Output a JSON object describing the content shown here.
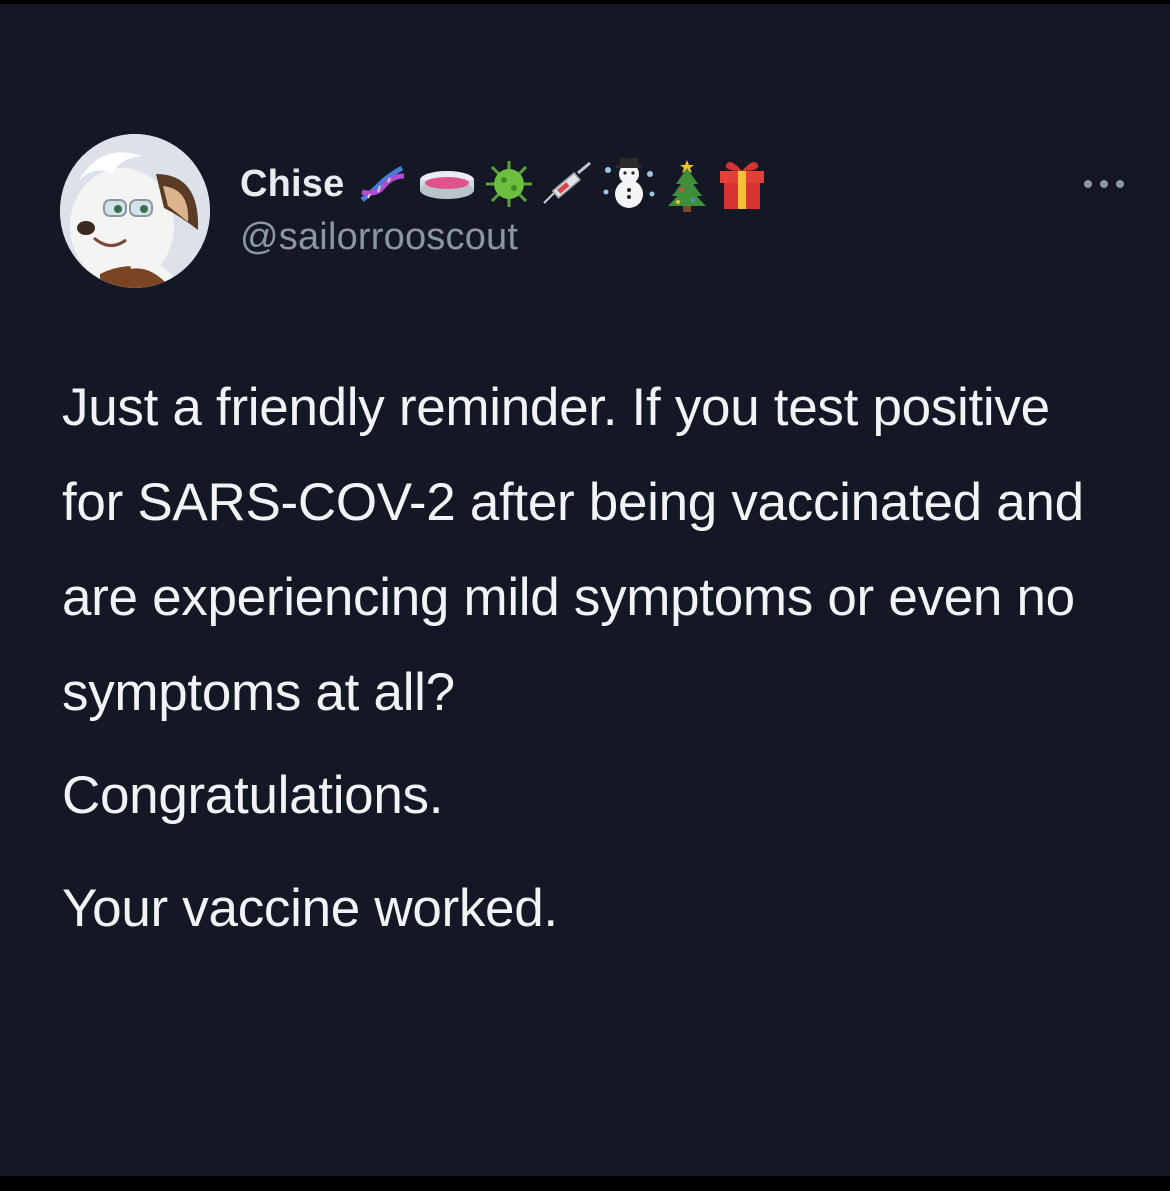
{
  "tweet": {
    "author": {
      "display_name": "Chise",
      "name_emojis": [
        "dna-icon",
        "petri-dish-icon",
        "virus-icon",
        "syringe-icon",
        "snowman-icon",
        "christmas-tree-icon",
        "gift-icon"
      ],
      "handle": "@sailorrooscout",
      "avatar": "anthro-character-avatar"
    },
    "more_icon": "more-options-icon",
    "paragraphs": [
      "Just a friendly reminder. If you test positive for SARS-COV-2 after being vaccinated and are experiencing mild symptoms or even no symptoms at all?",
      "Congratulations.",
      "Your vaccine worked."
    ]
  },
  "colors": {
    "background": "#141824",
    "text_primary": "#f1f3f6",
    "text_secondary": "#8b96a4"
  }
}
